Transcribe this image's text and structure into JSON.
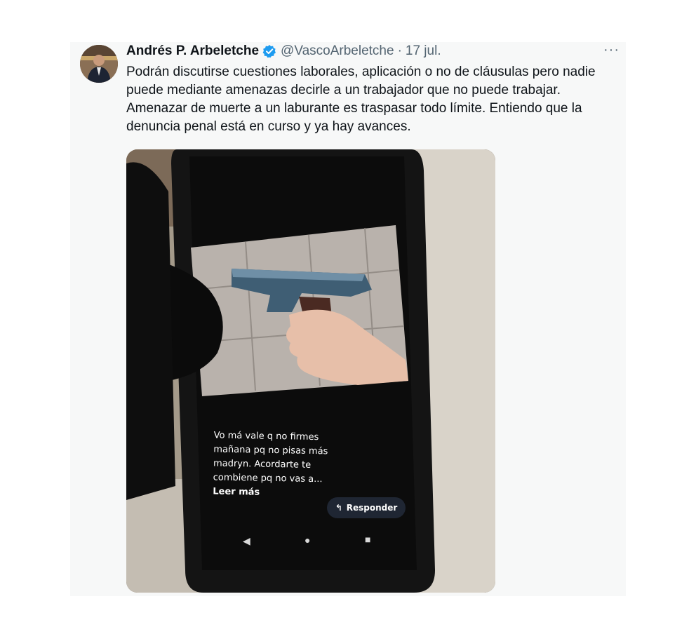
{
  "tweet": {
    "author_name": "Andrés P. Arbeletche",
    "handle": "@VascoArbeletche",
    "separator": "·",
    "date": "17 jul.",
    "more_glyph": "···",
    "text": "Podrán discutirse cuestiones laborales, aplicación o no de cláusulas pero nadie puede mediante amenazas decirle a un trabajador que no puede trabajar. Amenazar de muerte a un laburante es traspasar todo límite. Entiendo que la denuncia penal está en curso y ya hay avances."
  },
  "media": {
    "message_text": "Vo má vale q no firmes mañana pq no pisas más madryn. Acordarte te combiene  pq no vas a...",
    "read_more": "Leer más",
    "reply_label": "Responder",
    "reply_icon": "reply-arrow-icon",
    "nav_icons": [
      "back-triangle-icon",
      "home-circle-icon",
      "recents-square-icon"
    ]
  },
  "colors": {
    "verified_blue": "#1d9bf0",
    "text_primary": "#0f1419",
    "text_secondary": "#536471",
    "card_bg": "#f7f8f8"
  }
}
